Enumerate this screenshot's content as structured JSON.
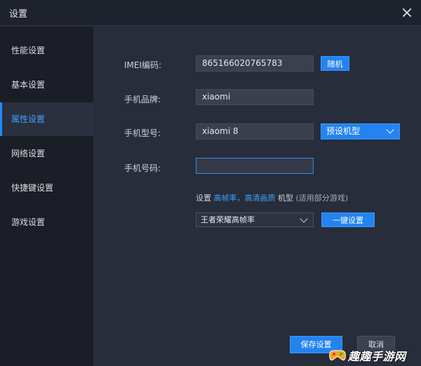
{
  "window": {
    "title": "设置"
  },
  "sidebar": {
    "items": [
      {
        "label": "性能设置"
      },
      {
        "label": "基本设置"
      },
      {
        "label": "属性设置"
      },
      {
        "label": "网络设置"
      },
      {
        "label": "快捷键设置"
      },
      {
        "label": "游戏设置"
      }
    ],
    "active_index": 2
  },
  "form": {
    "imei": {
      "label": "IMEI编码:",
      "value": "865166020765783",
      "button": "随机"
    },
    "brand": {
      "label": "手机品牌:",
      "value": "xiaomi"
    },
    "model": {
      "label": "手机型号:",
      "value": "xiaomi 8",
      "preset": "预设机型"
    },
    "phone": {
      "label": "手机号码:",
      "value": ""
    }
  },
  "hint": {
    "prefix": "设置",
    "highlight": "高帧率，高清画质",
    "suffix": "机型",
    "note": "(适用部分游戏)"
  },
  "game_preset": {
    "selected": "王者荣耀高帧率",
    "apply_button": "一键设置"
  },
  "footer": {
    "save_label": "保存设置",
    "cancel_label": "取消"
  },
  "watermark": {
    "text": "趣趣手游网"
  },
  "colors": {
    "accent": "#2384f0",
    "sidebar_bg": "#1b1e26",
    "content_bg": "#272d3a",
    "highlight_text": "#3fa1ff"
  }
}
